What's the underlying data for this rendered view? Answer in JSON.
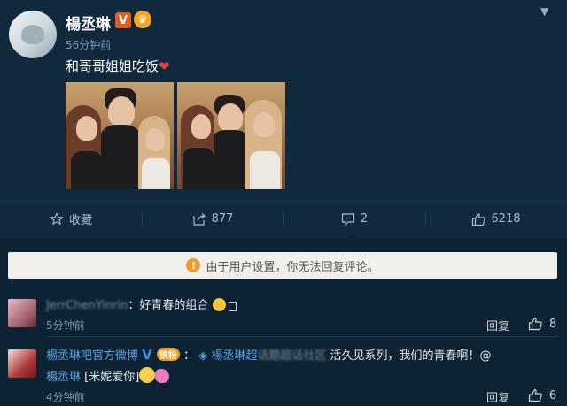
{
  "post": {
    "username": "楊丞琳",
    "verified_badge": "V",
    "time": "56分钟前",
    "text": "和哥哥姐姐吃饭",
    "heart_icon": "red-heart",
    "menu_icon": "chevron-down-icon"
  },
  "actions": {
    "favorite_label": "收藏",
    "share_count": "877",
    "comment_count": "2",
    "like_count": "6218"
  },
  "notice": {
    "icon": "!",
    "text": "由于用户设置，你无法回复评论。"
  },
  "comments": [
    {
      "author": "JerrChenYinrin",
      "text": "：好青春的组合",
      "time": "5分钟前",
      "reply_label": "回复",
      "like_count": "8"
    },
    {
      "author": "楊丞琳吧官方微博",
      "fan_badge": "铁粉",
      "colon": "：",
      "mention_group": "楊丞琳超",
      "mention_blurred": "话题超话社区",
      "text": "活久见系列，我们的青春啊！@",
      "mention_user": "楊丞琳",
      "emoji_text": "[米妮爱你]",
      "time": "4分钟前",
      "reply_label": "回复",
      "like_count": "6"
    }
  ],
  "colors": {
    "background": "#0f2a3f",
    "link": "#5ba3e6",
    "accent_orange": "#f29a2e"
  }
}
